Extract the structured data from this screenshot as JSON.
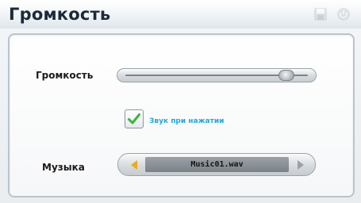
{
  "title": "Громкость",
  "volume": {
    "label": "Громкость",
    "level": 0.9
  },
  "touch_sound": {
    "label": "Звук при нажатии",
    "checked": true
  },
  "music": {
    "label": "Музыка",
    "value": "Music01.wav"
  },
  "icons": {
    "save": "save-icon",
    "power": "power-icon",
    "prev": "arrow-left-icon",
    "next": "arrow-right-icon",
    "check": "checkmark-icon"
  },
  "colors": {
    "accent": "#23a7d8",
    "check": "#3cb43c",
    "prev_arrow": "#f0a81c"
  }
}
